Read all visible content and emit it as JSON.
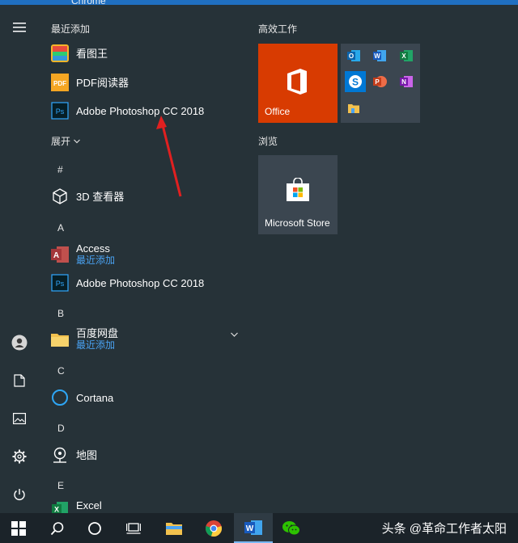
{
  "window_title": "Chrome",
  "rail": {
    "items": [
      {
        "name": "hamburger-menu-icon"
      },
      {
        "name": "user-icon"
      },
      {
        "name": "documents-icon"
      },
      {
        "name": "pictures-icon"
      },
      {
        "name": "settings-gear-icon"
      },
      {
        "name": "power-icon"
      }
    ]
  },
  "applist": {
    "recent_header": "最近添加",
    "recent": [
      {
        "name": "看图王",
        "icon": "picture-viewer-icon"
      },
      {
        "name": "PDF阅读器",
        "icon": "pdf-reader-icon"
      },
      {
        "name": "Adobe Photoshop CC 2018",
        "icon": "photoshop-icon"
      }
    ],
    "expand_label": "展开",
    "sections": {
      "hash": "#",
      "a": "A",
      "b": "B",
      "c": "C",
      "d": "D",
      "e": "E"
    },
    "apps": {
      "viewer3d": "3D 查看器",
      "access": "Access",
      "access_sub": "最近添加",
      "photoshop": "Adobe Photoshop CC 2018",
      "baidu": "百度网盘",
      "baidu_sub": "最近添加",
      "cortana": "Cortana",
      "maps": "地图",
      "excel": "Excel"
    }
  },
  "tiles": {
    "productivity_header": "高效工作",
    "office_label": "Office",
    "browse_header": "浏览",
    "store_label": "Microsoft Store",
    "colors": {
      "office": "#d83b01",
      "group": "#3b4650",
      "store": "#3b4650"
    }
  },
  "taskbar": {
    "watermark": "头条 @革命工作者太阳",
    "items": [
      "windows-start-icon",
      "search-icon",
      "cortana-icon",
      "task-view-icon",
      "file-explorer-icon",
      "chrome-icon",
      "word-icon",
      "wechat-icon"
    ]
  }
}
